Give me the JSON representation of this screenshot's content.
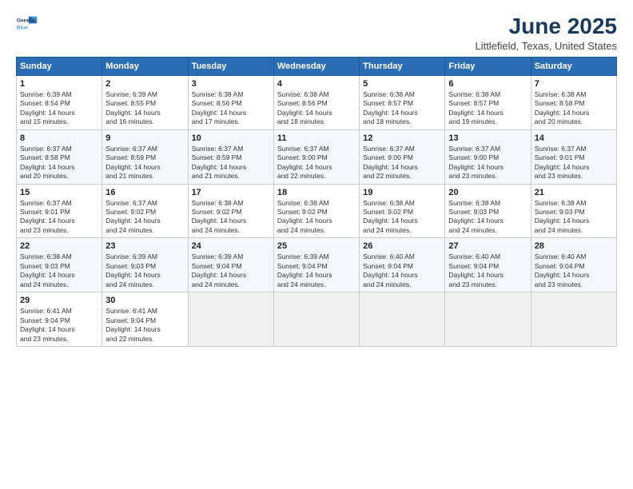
{
  "header": {
    "logo_line1": "General",
    "logo_line2": "Blue",
    "title": "June 2025",
    "subtitle": "Littlefield, Texas, United States"
  },
  "days_of_week": [
    "Sunday",
    "Monday",
    "Tuesday",
    "Wednesday",
    "Thursday",
    "Friday",
    "Saturday"
  ],
  "weeks": [
    [
      {
        "day": 1,
        "info": "Sunrise: 6:39 AM\nSunset: 8:54 PM\nDaylight: 14 hours\nand 15 minutes."
      },
      {
        "day": 2,
        "info": "Sunrise: 6:39 AM\nSunset: 8:55 PM\nDaylight: 14 hours\nand 16 minutes."
      },
      {
        "day": 3,
        "info": "Sunrise: 6:38 AM\nSunset: 8:56 PM\nDaylight: 14 hours\nand 17 minutes."
      },
      {
        "day": 4,
        "info": "Sunrise: 6:38 AM\nSunset: 8:56 PM\nDaylight: 14 hours\nand 18 minutes."
      },
      {
        "day": 5,
        "info": "Sunrise: 6:38 AM\nSunset: 8:57 PM\nDaylight: 14 hours\nand 18 minutes."
      },
      {
        "day": 6,
        "info": "Sunrise: 6:38 AM\nSunset: 8:57 PM\nDaylight: 14 hours\nand 19 minutes."
      },
      {
        "day": 7,
        "info": "Sunrise: 6:38 AM\nSunset: 8:58 PM\nDaylight: 14 hours\nand 20 minutes."
      }
    ],
    [
      {
        "day": 8,
        "info": "Sunrise: 6:37 AM\nSunset: 8:58 PM\nDaylight: 14 hours\nand 20 minutes."
      },
      {
        "day": 9,
        "info": "Sunrise: 6:37 AM\nSunset: 8:59 PM\nDaylight: 14 hours\nand 21 minutes."
      },
      {
        "day": 10,
        "info": "Sunrise: 6:37 AM\nSunset: 8:59 PM\nDaylight: 14 hours\nand 21 minutes."
      },
      {
        "day": 11,
        "info": "Sunrise: 6:37 AM\nSunset: 9:00 PM\nDaylight: 14 hours\nand 22 minutes."
      },
      {
        "day": 12,
        "info": "Sunrise: 6:37 AM\nSunset: 9:00 PM\nDaylight: 14 hours\nand 22 minutes."
      },
      {
        "day": 13,
        "info": "Sunrise: 6:37 AM\nSunset: 9:00 PM\nDaylight: 14 hours\nand 23 minutes."
      },
      {
        "day": 14,
        "info": "Sunrise: 6:37 AM\nSunset: 9:01 PM\nDaylight: 14 hours\nand 23 minutes."
      }
    ],
    [
      {
        "day": 15,
        "info": "Sunrise: 6:37 AM\nSunset: 9:01 PM\nDaylight: 14 hours\nand 23 minutes."
      },
      {
        "day": 16,
        "info": "Sunrise: 6:37 AM\nSunset: 9:02 PM\nDaylight: 14 hours\nand 24 minutes."
      },
      {
        "day": 17,
        "info": "Sunrise: 6:38 AM\nSunset: 9:02 PM\nDaylight: 14 hours\nand 24 minutes."
      },
      {
        "day": 18,
        "info": "Sunrise: 6:38 AM\nSunset: 9:02 PM\nDaylight: 14 hours\nand 24 minutes."
      },
      {
        "day": 19,
        "info": "Sunrise: 6:38 AM\nSunset: 9:02 PM\nDaylight: 14 hours\nand 24 minutes."
      },
      {
        "day": 20,
        "info": "Sunrise: 6:38 AM\nSunset: 9:03 PM\nDaylight: 14 hours\nand 24 minutes."
      },
      {
        "day": 21,
        "info": "Sunrise: 6:38 AM\nSunset: 9:03 PM\nDaylight: 14 hours\nand 24 minutes."
      }
    ],
    [
      {
        "day": 22,
        "info": "Sunrise: 6:38 AM\nSunset: 9:03 PM\nDaylight: 14 hours\nand 24 minutes."
      },
      {
        "day": 23,
        "info": "Sunrise: 6:39 AM\nSunset: 9:03 PM\nDaylight: 14 hours\nand 24 minutes."
      },
      {
        "day": 24,
        "info": "Sunrise: 6:39 AM\nSunset: 9:04 PM\nDaylight: 14 hours\nand 24 minutes."
      },
      {
        "day": 25,
        "info": "Sunrise: 6:39 AM\nSunset: 9:04 PM\nDaylight: 14 hours\nand 24 minutes."
      },
      {
        "day": 26,
        "info": "Sunrise: 6:40 AM\nSunset: 9:04 PM\nDaylight: 14 hours\nand 24 minutes."
      },
      {
        "day": 27,
        "info": "Sunrise: 6:40 AM\nSunset: 9:04 PM\nDaylight: 14 hours\nand 23 minutes."
      },
      {
        "day": 28,
        "info": "Sunrise: 6:40 AM\nSunset: 9:04 PM\nDaylight: 14 hours\nand 23 minutes."
      }
    ],
    [
      {
        "day": 29,
        "info": "Sunrise: 6:41 AM\nSunset: 9:04 PM\nDaylight: 14 hours\nand 23 minutes."
      },
      {
        "day": 30,
        "info": "Sunrise: 6:41 AM\nSunset: 9:04 PM\nDaylight: 14 hours\nand 22 minutes."
      },
      null,
      null,
      null,
      null,
      null
    ]
  ]
}
